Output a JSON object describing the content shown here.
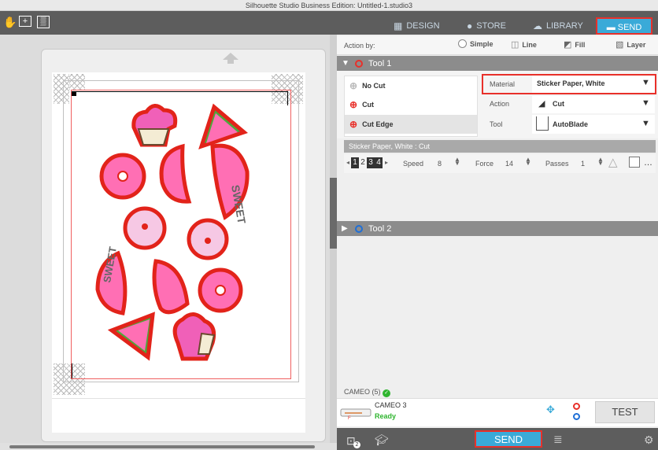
{
  "window": {
    "title": "Silhouette Studio Business Edition: Untitled-1.studio3"
  },
  "toolbar": {
    "icons": [
      "hand-icon",
      "zoom-box-icon",
      "pattern-icon"
    ]
  },
  "tabs": {
    "design": "DESIGN",
    "store": "STORE",
    "library": "LIBRARY",
    "send": "SEND"
  },
  "action_by": {
    "label": "Action by:",
    "options": [
      "Simple",
      "Line",
      "Fill",
      "Layer"
    ],
    "selected": "Simple"
  },
  "tool1": {
    "title": "Tool 1",
    "cut_options": [
      "No Cut",
      "Cut",
      "Cut Edge"
    ],
    "selected": "Cut Edge",
    "material_label": "Material",
    "material_value": "Sticker Paper, White",
    "action_label": "Action",
    "action_value": "Cut",
    "tool_label": "Tool",
    "tool_value": "AutoBlade",
    "summary": "Sticker Paper, White : Cut",
    "blade_digits": [
      "1",
      "2",
      "3",
      "4"
    ],
    "speed_label": "Speed",
    "speed_value": "8",
    "force_label": "Force",
    "force_value": "14",
    "passes_label": "Passes",
    "passes_value": "1"
  },
  "tool2": {
    "title": "Tool 2"
  },
  "device": {
    "list_label": "CAMEO (5)",
    "name": "CAMEO 3",
    "status": "Ready",
    "test_label": "TEST"
  },
  "bottom": {
    "send_label": "SEND",
    "badge": "2"
  },
  "colors": {
    "accent": "#3aaad8",
    "highlight": "#e8302a",
    "ready": "#2fb52f",
    "sticker_pink": "#f060b8",
    "melon_green": "#4ca83c"
  }
}
